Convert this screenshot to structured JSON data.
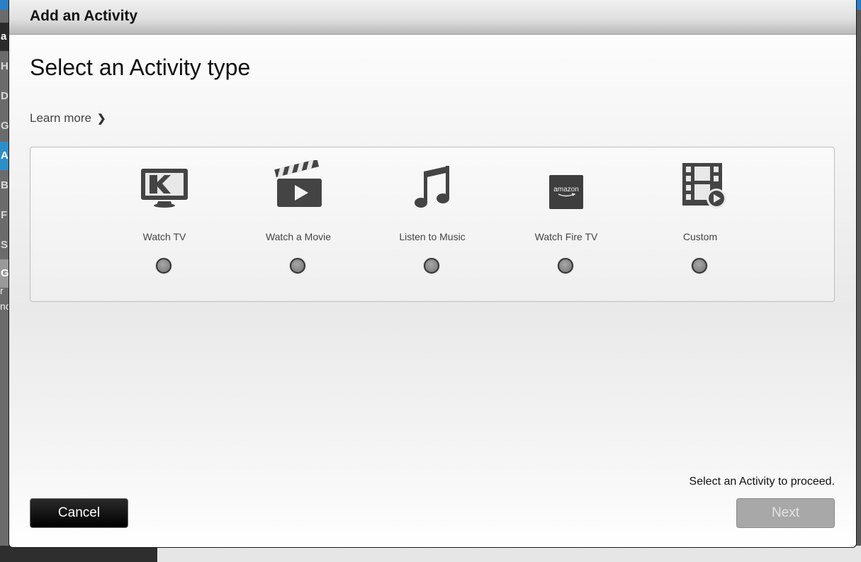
{
  "background": {
    "left_letters": [
      "a",
      "H",
      "D",
      "G",
      "A",
      "B",
      "F",
      "S",
      "G"
    ],
    "left_snippets": [
      "r",
      "nc"
    ]
  },
  "modal": {
    "title": "Add an Activity",
    "heading": "Select an Activity type",
    "learn_more": "Learn more",
    "activities": [
      {
        "label": "Watch TV",
        "icon": "tv-icon",
        "selected": false
      },
      {
        "label": "Watch a Movie",
        "icon": "clapperboard-icon",
        "selected": false
      },
      {
        "label": "Listen to Music",
        "icon": "music-note-icon",
        "selected": false
      },
      {
        "label": "Watch Fire TV",
        "icon": "amazon-fire-tv-icon",
        "selected": false
      },
      {
        "label": "Custom",
        "icon": "film-strip-play-icon",
        "selected": false
      }
    ],
    "amazon_logo_text": "amazon",
    "status_text": "Select an Activity to proceed.",
    "cancel_label": "Cancel",
    "next_label": "Next",
    "next_enabled": false
  },
  "colors": {
    "accent": "#2d8fc9",
    "cancel_bg": "#000000",
    "next_disabled_bg": "#a8a8a8"
  }
}
